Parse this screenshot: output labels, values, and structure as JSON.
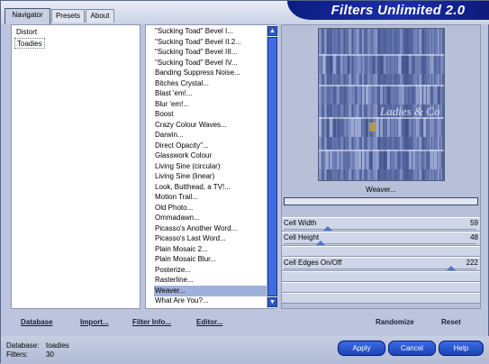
{
  "title": "Filters Unlimited 2.0",
  "tabs": [
    "Navigator",
    "Presets",
    "About"
  ],
  "categories": [
    "Distort",
    "Toadies"
  ],
  "selected_category": "Toadies",
  "filters": [
    "\"Sucking Toad\"  Bevel I...",
    "\"Sucking Toad\"  Bevel II.2...",
    "\"Sucking Toad\"  Bevel III...",
    "\"Sucking Toad\"  Bevel IV...",
    "Banding Suppress Noise...",
    "Bitches Crystal...",
    "Blast 'em!...",
    "Blur 'em!...",
    "Boost",
    "Crazy Colour Waves...",
    "Darwin...",
    "Direct Opacity\"...",
    "Glasswork Colour",
    "Living Sine (circular)",
    "Living Sine (linear)",
    "Look, Butthead, a TV!...",
    "Motion Trail...",
    "Old Photo...",
    "Ommadawn...",
    "Picasso's Another Word...",
    "Picasso's Last Word...",
    "Plain Mosaic 2...",
    "Plain Mosaic Blur...",
    "Posterize...",
    "Rasterline...",
    "Weaver...",
    "What Are You?..."
  ],
  "selected_filter": "Weaver...",
  "preview": {
    "watermark": "Ladies & Co"
  },
  "filter_name": "Weaver...",
  "params": [
    {
      "label": "Cell Width",
      "value": "59",
      "level": 0.23
    },
    {
      "label": "Cell Height",
      "value": "48",
      "level": 0.19
    },
    {
      "label": "Cell Edges On/Off",
      "value": "222",
      "level": 0.87
    }
  ],
  "left_buttons": [
    "Database",
    "Import...",
    "Filter Info...",
    "Editor..."
  ],
  "right_buttons": [
    "Randomize",
    "Reset"
  ],
  "status": {
    "database_label": "Database:",
    "database_value": "toadies",
    "filters_label": "Filters:",
    "filters_value": "30"
  },
  "actions": [
    "Apply",
    "Cancel",
    "Help"
  ],
  "colors": {
    "accent": "#1c43b8",
    "title_bar": "#0c1c82",
    "selection": "#9fb0d9",
    "background": "#bcc5dd"
  }
}
